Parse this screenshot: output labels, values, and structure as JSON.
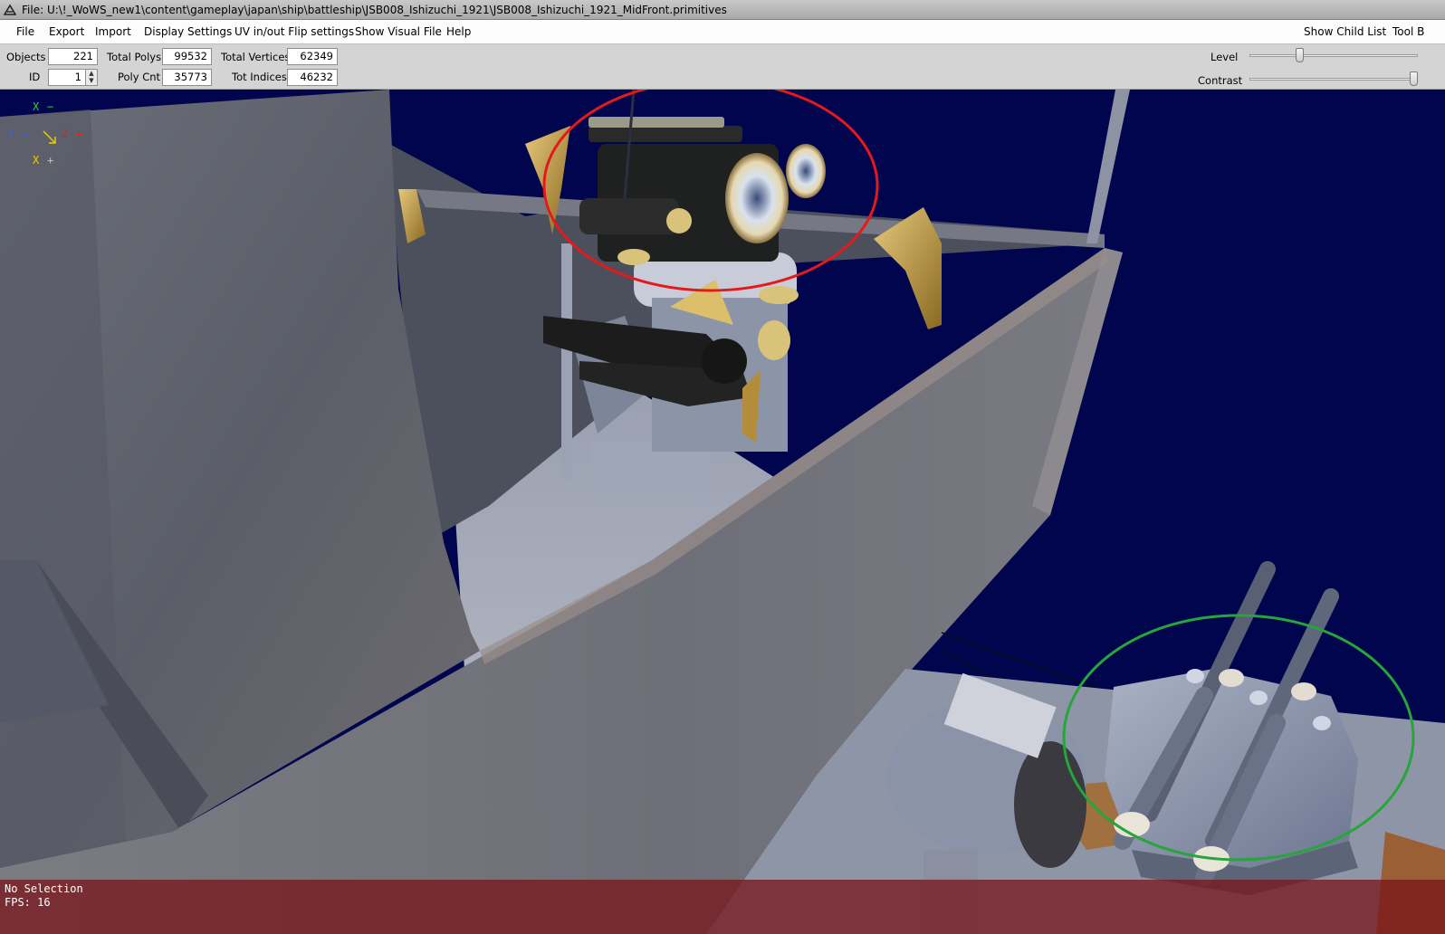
{
  "window": {
    "title": "File: U:\\!_WoWS_new1\\content\\gameplay\\japan\\ship\\battleship\\JSB008_Ishizuchi_1921\\JSB008_Ishizuchi_1921_MidFront.primitives"
  },
  "menu": {
    "file": "File",
    "export": "Export",
    "import": "Import",
    "display_settings": "Display Settings",
    "uv_flip": "UV in/out Flip settings",
    "show_visual_file": "Show Visual File",
    "help": "Help",
    "show_child_list": "Show Child List",
    "tool": "Tool B"
  },
  "stats": {
    "objects_label": "Objects",
    "objects_value": "221",
    "id_label": "ID",
    "id_value": "1",
    "total_polys_label": "Total Polys",
    "total_polys_value": "99532",
    "poly_cnt_label": "Poly Cnt",
    "poly_cnt_value": "35773",
    "total_vertices_label": "Total Vertices",
    "total_vertices_value": "62349",
    "tot_indices_label": "Tot Indices",
    "tot_indices_value": "46232"
  },
  "sliders": {
    "level_label": "Level",
    "level_value": 0.29,
    "contrast_label": "Contrast",
    "contrast_value": 1.0
  },
  "gizmo": {
    "x_top": "X",
    "x_top_sign": "−",
    "z_left": "Z",
    "z_left_sign": "−",
    "z_right": "Z",
    "z_right_sign": "+",
    "x_bottom": "X",
    "x_bottom_sign": "+"
  },
  "status": {
    "selection": "No Selection",
    "fps": "FPS: 16"
  },
  "colors": {
    "viewport_bg": "#00054d",
    "red_highlight": "#e5191c",
    "green_highlight": "#25a53a",
    "status_bg": "#7a1419"
  }
}
